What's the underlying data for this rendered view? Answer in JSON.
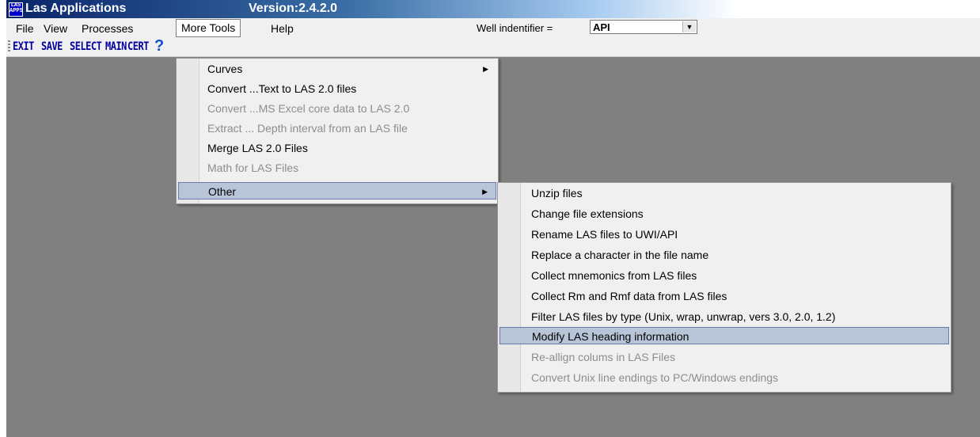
{
  "titlebar": {
    "icon_text": "LAS APPS",
    "title": "Las Applications",
    "version": "Version:2.4.2.0"
  },
  "menubar": {
    "items": [
      {
        "label": "File"
      },
      {
        "label": "View"
      },
      {
        "label": "Processes"
      },
      {
        "label": "More Tools"
      },
      {
        "label": "Help"
      }
    ],
    "well_identifier_label": "Well indentifier =",
    "well_identifier_value": "API"
  },
  "toolbar": {
    "buttons": [
      "EXIT",
      "SAVE",
      "SELECT",
      "MAIN",
      "CERT"
    ],
    "help_icon": "question-icon"
  },
  "more_tools_menu": [
    {
      "label": "Curves",
      "enabled": true,
      "submenu": true
    },
    {
      "label": "Convert ...Text to LAS 2.0 files",
      "enabled": true
    },
    {
      "label": "Convert ...MS Excel core data to LAS 2.0",
      "enabled": false
    },
    {
      "label": "Extract ... Depth interval from an LAS file",
      "enabled": false
    },
    {
      "label": "Merge LAS 2.0 Files",
      "enabled": true
    },
    {
      "label": "Math for LAS Files",
      "enabled": false
    },
    {
      "label": "Other",
      "enabled": true,
      "submenu": true,
      "highlighted": true
    }
  ],
  "other_submenu": [
    {
      "label": "Unzip files",
      "enabled": true
    },
    {
      "label": "Change file extensions",
      "enabled": true
    },
    {
      "label": "Rename LAS files to UWI/API",
      "enabled": true
    },
    {
      "label": "Replace a character in the file name",
      "enabled": true
    },
    {
      "label": "Collect mnemonics from LAS files",
      "enabled": true
    },
    {
      "label": "Collect Rm and Rmf data from LAS files",
      "enabled": true
    },
    {
      "label": "Filter LAS files by type (Unix, wrap, unwrap, vers 3.0, 2.0, 1.2)",
      "enabled": true
    },
    {
      "label": "Modify LAS heading information",
      "enabled": true,
      "highlighted": true
    },
    {
      "label": "Re-allign colums in  LAS Files",
      "enabled": false
    },
    {
      "label": "Convert Unix line endings to PC/Windows endings",
      "enabled": false
    }
  ]
}
